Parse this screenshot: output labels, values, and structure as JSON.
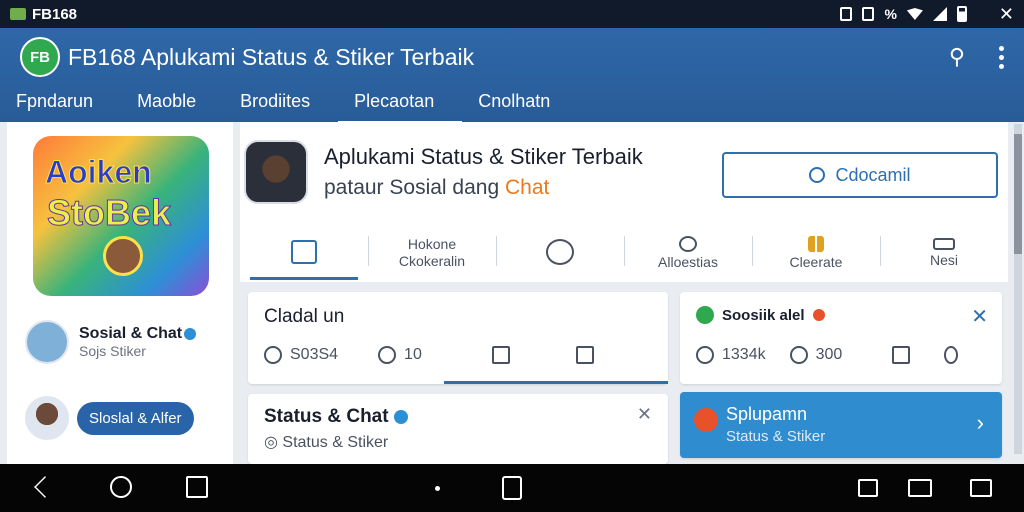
{
  "statusbar": {
    "app_name": "FB168"
  },
  "appbar": {
    "logo_text": "FB",
    "title": "FB168  Aplukami Status & Stiker Terbaik",
    "tabs": [
      {
        "label": "Fpndarun"
      },
      {
        "label": "Maoble"
      },
      {
        "label": "Brodiites"
      },
      {
        "label": "Plecaotan"
      },
      {
        "label": "Cnolhatn"
      }
    ],
    "active_tab": 3
  },
  "leftcol": {
    "feature_text_1": "Aoiken",
    "feature_text_2": "StoBek",
    "items": [
      {
        "name": "Sosial & Chat",
        "sub": "Sojs  Stiker"
      },
      {
        "pill": "Sloslal & Alfer"
      }
    ]
  },
  "main": {
    "title": "Aplukami Status & Stiker Terbaik",
    "subtitle_prefix": "pataur Sosial dang ",
    "subtitle_highlight": "Chat",
    "cta_label": "Cdocamil",
    "sections": [
      {
        "label": "",
        "icon": "home-icon"
      },
      {
        "label": "Hokone\nCkokeralin",
        "icon": "none"
      },
      {
        "label": "",
        "icon": "chat-bubble-icon"
      },
      {
        "label": "Alloestias",
        "icon": "alarm-icon"
      },
      {
        "label": "Cleerate",
        "icon": "bars-icon"
      },
      {
        "label": "Nesi",
        "icon": "window-icon"
      }
    ]
  },
  "cards": {
    "card1": {
      "title": "Cladal un",
      "comments": "S03S4",
      "shares": "10"
    },
    "card2": {
      "title": "Soosiik alel",
      "likes": "1334k",
      "hearts": "300"
    },
    "card3": {
      "title": "Status & Chat",
      "sub": "Status & Stiker"
    },
    "card4": {
      "title": "Splupamn",
      "sub": "Status & Stiker"
    }
  },
  "colors": {
    "appbar": "#2e67a8",
    "accent": "#2e6fb0",
    "highlight": "#ec7a1c",
    "card4_bg": "#2e8ccf"
  }
}
